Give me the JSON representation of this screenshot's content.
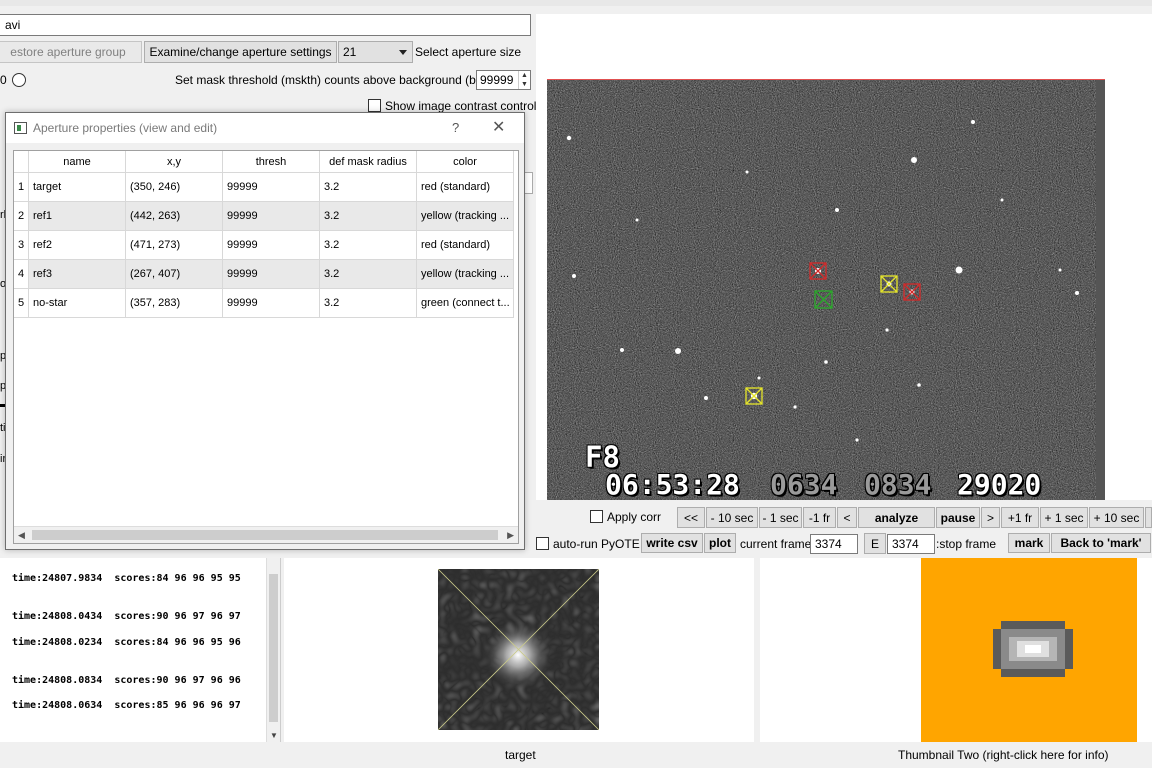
{
  "top": {
    "file_path": "avi",
    "restore_button": "estore aperture group",
    "examine_button": "Examine/change aperture settings",
    "aperture_size_value": "21",
    "select_aperture_size_label": "Select aperture size",
    "radio_label": "0",
    "mask_threshold_label": "Set mask threshold (mskth) counts above background (bkavg)",
    "mask_threshold_value": "99999",
    "show_contrast_label": "Show image contrast control"
  },
  "left_fragments": [
    "rl",
    "ol",
    "p",
    "p",
    "ti",
    "ir"
  ],
  "dialog": {
    "title": "Aperture properties (view and edit)",
    "help": "?",
    "close": "✕",
    "columns": [
      "name",
      "x,y",
      "thresh",
      "def mask radius",
      "color"
    ],
    "rows": [
      {
        "num": "1",
        "name": "target",
        "xy": "(350, 246)",
        "thresh": "99999",
        "radius": "3.2",
        "color": "red (standard)"
      },
      {
        "num": "2",
        "name": "ref1",
        "xy": "(442, 263)",
        "thresh": "99999",
        "radius": "3.2",
        "color": "yellow (tracking ..."
      },
      {
        "num": "3",
        "name": "ref2",
        "xy": "(471, 273)",
        "thresh": "99999",
        "radius": "3.2",
        "color": "red (standard)"
      },
      {
        "num": "4",
        "name": "ref3",
        "xy": "(267, 407)",
        "thresh": "99999",
        "radius": "3.2",
        "color": "yellow (tracking ..."
      },
      {
        "num": "5",
        "name": "no-star",
        "xy": "(357, 283)",
        "thresh": "99999",
        "radius": "3.2",
        "color": "green (connect t..."
      }
    ]
  },
  "video": {
    "osd_field": "F8",
    "osd_time": "06:53:28",
    "osd_a": "0634",
    "osd_b": "0834",
    "osd_c": "29020"
  },
  "playback": {
    "apply_corr": "Apply corr",
    "rewind": "<<",
    "minus_10": "- 10 sec",
    "minus_1": "- 1 sec",
    "minus_fr": "-1 fr",
    "back": "<",
    "analyze": "analyze",
    "pause": "pause",
    "forward": ">",
    "plus_fr": "+1 fr",
    "plus_1": "+ 1 sec",
    "plus_10": "+ 10 sec",
    "autorun": "auto-run PyOTE",
    "write_csv": "write csv",
    "plot": "plot",
    "current_frame_label": "current frame:",
    "current_frame_value": "3374",
    "e_button": "E",
    "stop_frame_value": "3374",
    "stop_frame_label": ":stop frame",
    "mark": "mark",
    "back_to_mark": "Back to 'mark'"
  },
  "log": [
    "time:24807.9834  scores:84 96 96 95 95",
    "time:24808.0434  scores:90 96 97 96 97",
    "time:24808.0234  scores:84 96 96 95 96",
    "time:24808.0834  scores:90 96 97 96 96",
    "time:24808.0634  scores:85 96 96 96 97"
  ],
  "bottom": {
    "target_label": "target",
    "thumb2_label": "Thumbnail Two (right-click here for info)"
  },
  "colors": {
    "aperture_red": "#d42a2a",
    "aperture_yellow": "#e6e62a",
    "aperture_green": "#2aa82a",
    "thumb2_bg": "#ffa500"
  }
}
